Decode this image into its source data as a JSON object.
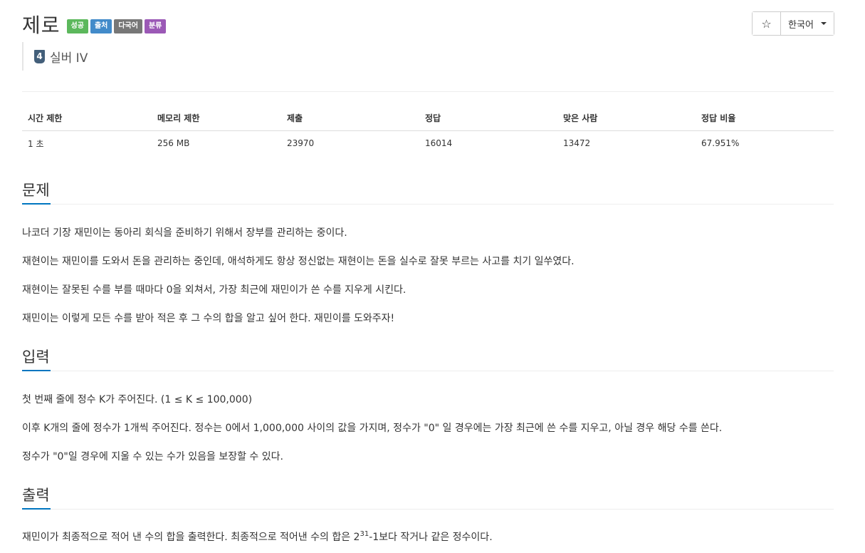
{
  "problem": {
    "title": "제로",
    "badges": {
      "success": "성공",
      "source": "출처",
      "multilang": "다국어",
      "tags": "분류"
    },
    "tier_number": "4",
    "tier_label": "실버 IV"
  },
  "controls": {
    "star": "☆",
    "language": "한국어"
  },
  "info_table": {
    "headers": [
      "시간 제한",
      "메모리 제한",
      "제출",
      "정답",
      "맞은 사람",
      "정답 비율"
    ],
    "values": [
      "1 초",
      "256 MB",
      "23970",
      "16014",
      "13472",
      "67.951%"
    ]
  },
  "sections": {
    "description": {
      "title": "문제",
      "paragraphs": [
        "나코더 기장 재민이는 동아리 회식을 준비하기 위해서 장부를 관리하는 중이다.",
        "재현이는 재민이를 도와서 돈을 관리하는 중인데, 애석하게도 항상 정신없는 재현이는 돈을 실수로 잘못 부르는 사고를 치기 일쑤였다.",
        "재현이는 잘못된 수를 부를 때마다 0을 외쳐서, 가장 최근에 재민이가 쓴 수를 지우게 시킨다.",
        "재민이는 이렇게 모든 수를 받아 적은 후 그 수의 합을 알고 싶어 한다. 재민이를 도와주자!"
      ]
    },
    "input": {
      "title": "입력",
      "paragraphs": [
        "첫 번째 줄에 정수 K가 주어진다. (1 ≤ K ≤ 100,000)",
        "이후 K개의 줄에 정수가 1개씩 주어진다. 정수는 0에서 1,000,000 사이의 값을 가지며, 정수가 \"0\" 일 경우에는 가장 최근에 쓴 수를 지우고, 아닐 경우 해당 수를 쓴다.",
        "정수가 \"0\"일 경우에 지울 수 있는 수가 있음을 보장할 수 있다."
      ]
    },
    "output": {
      "title": "출력",
      "text_before": "재민이가 최종적으로 적어 낸 수의 합을 출력한다. 최종적으로 적어낸 수의 합은 2",
      "superscript": "31",
      "text_after": "-1보다 작거나 같은 정수이다."
    }
  }
}
